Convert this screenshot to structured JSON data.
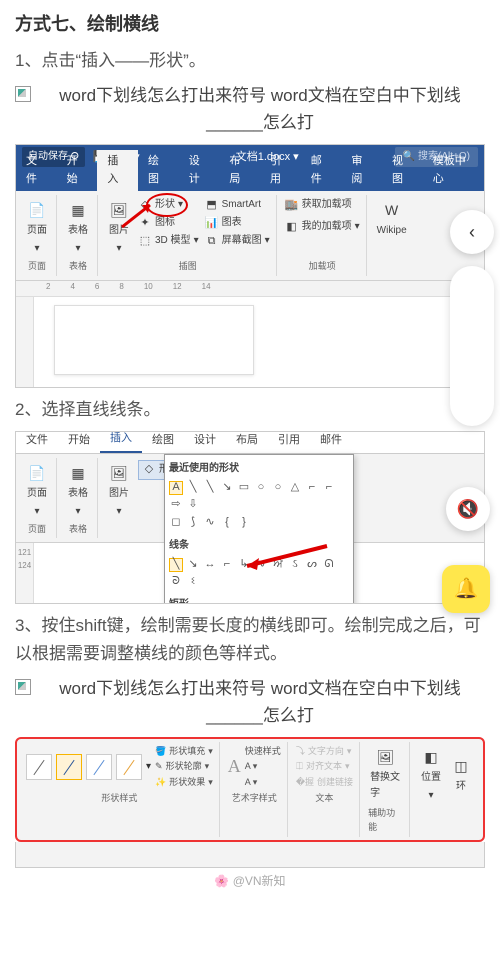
{
  "heading": "方式七、绘制横线",
  "step1": "1、点击“插入——形状”。",
  "alt_text": "word下划线怎么打出来符号 word文档在空白中下划线______怎么打",
  "step2": "2、选择直线线条。",
  "step3": "3、按住shift键，绘制需要长度的横线即可。绘制完成之后，可以根据需要调整横线的颜色等样式。",
  "watermark": "🌸 @VN新知",
  "word": {
    "autosave": "自动保存",
    "doc_name": "文档1.docx ▾",
    "search": "搜索(Alt+Q)",
    "search_icon": "🔍",
    "tabs": [
      "文件",
      "开始",
      "插入",
      "绘图",
      "设计",
      "布局",
      "引用",
      "邮件",
      "审阅",
      "视图",
      "模板中心"
    ],
    "tabs2": [
      "文件",
      "开始",
      "插入",
      "绘图",
      "设计",
      "布局",
      "引用",
      "邮件"
    ],
    "groups": {
      "page": {
        "label": "页面",
        "btn": "页面"
      },
      "table": {
        "label": "表格",
        "btn": "表格"
      },
      "illus": {
        "label": "插图",
        "pic": "图片",
        "shapes": "形状",
        "icons": "图标",
        "model": "3D 模型",
        "smartart": "SmartArt",
        "chart": "图表",
        "screenshot": "屏幕截图"
      },
      "addin": {
        "label": "加载项",
        "get": "获取加载项",
        "my": "我的加载项",
        "wiki": "Wikipe"
      }
    },
    "shapes_dd": {
      "recent": "最近使用的形状",
      "lines": "线条",
      "rect": "矩形"
    },
    "ruler_h": [
      "2",
      "4",
      "6",
      "8",
      "10",
      "12",
      "14"
    ],
    "ruler_v": [
      "",
      "121",
      "124"
    ]
  },
  "format": {
    "group_style": "形状样式",
    "group_wordart": "艺术字样式",
    "group_text": "文本",
    "group_assist": "辅助功能",
    "fill": "形状填充",
    "outline": "形状轮廓",
    "effects": "形状效果",
    "quick": "快速样式",
    "textdir": "文字方向",
    "align": "对齐文本",
    "link": "创建链接",
    "alttext": "替换文字",
    "pos": "位置",
    "wrap": "环"
  }
}
